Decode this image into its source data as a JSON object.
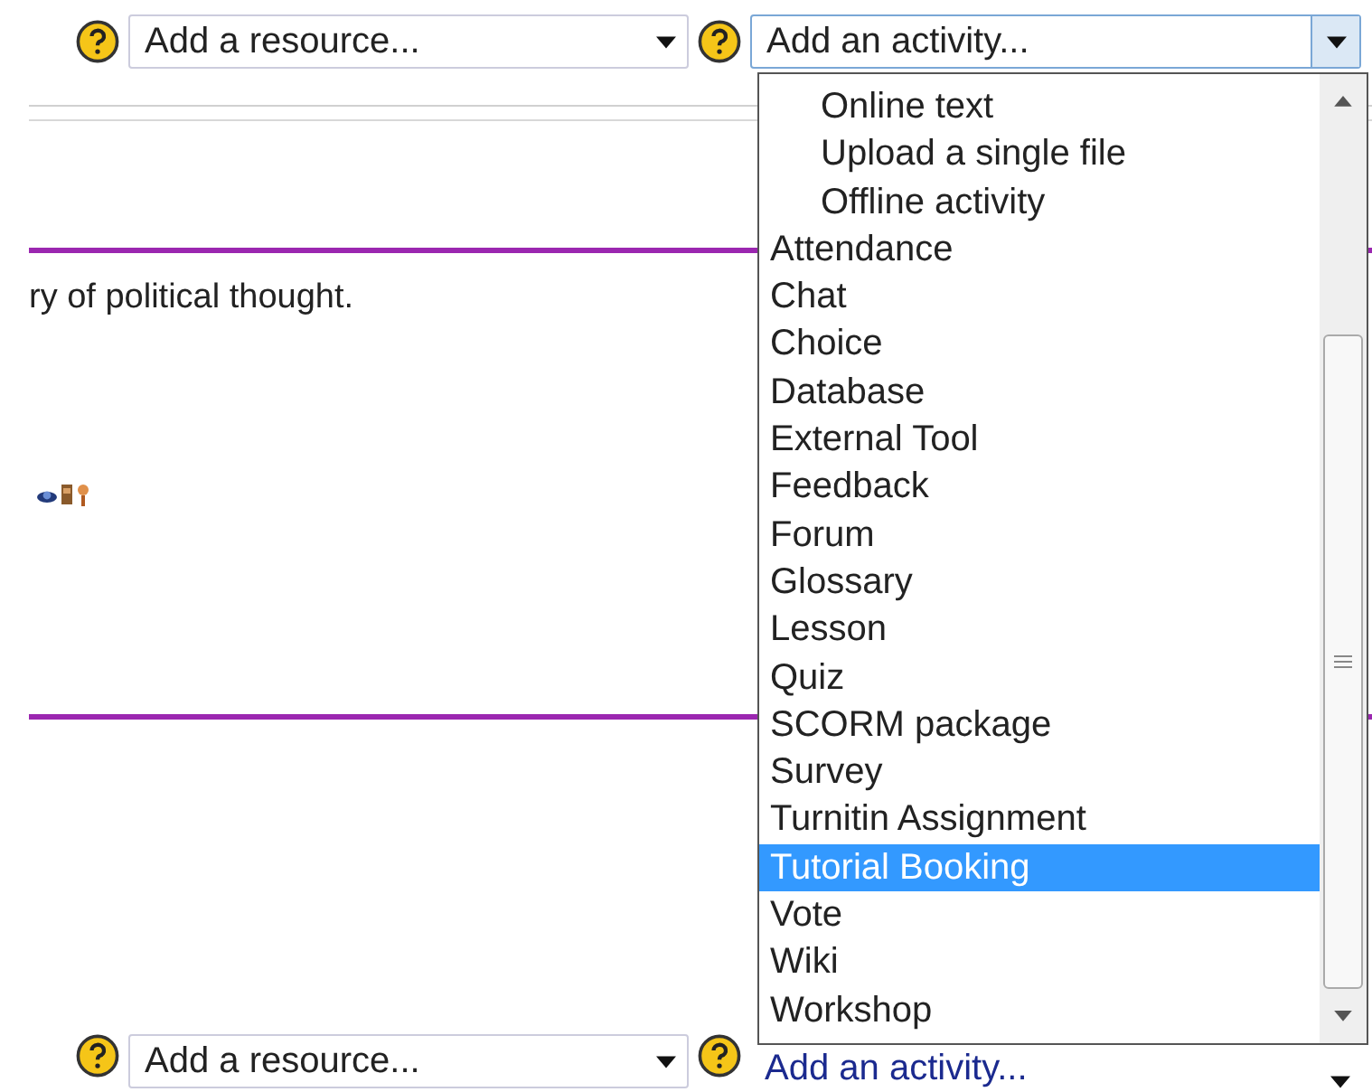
{
  "top_controls": {
    "resource_select": {
      "value": "Add a resource..."
    },
    "activity_select": {
      "value": "Add an activity...",
      "expanded": true
    }
  },
  "content": {
    "text": "ry of political thought."
  },
  "activity_list": [
    {
      "label": "Online text",
      "kind": "subitem",
      "selected": false
    },
    {
      "label": "Upload a single file",
      "kind": "subitem",
      "selected": false
    },
    {
      "label": "Offline activity",
      "kind": "subitem",
      "selected": false
    },
    {
      "label": "Attendance",
      "kind": "item",
      "selected": false
    },
    {
      "label": "Chat",
      "kind": "item",
      "selected": false
    },
    {
      "label": "Choice",
      "kind": "item",
      "selected": false
    },
    {
      "label": "Database",
      "kind": "item",
      "selected": false
    },
    {
      "label": "External Tool",
      "kind": "item",
      "selected": false
    },
    {
      "label": "Feedback",
      "kind": "item",
      "selected": false
    },
    {
      "label": "Forum",
      "kind": "item",
      "selected": false
    },
    {
      "label": "Glossary",
      "kind": "item",
      "selected": false
    },
    {
      "label": "Lesson",
      "kind": "item",
      "selected": false
    },
    {
      "label": "Quiz",
      "kind": "item",
      "selected": false
    },
    {
      "label": "SCORM package",
      "kind": "item",
      "selected": false
    },
    {
      "label": "Survey",
      "kind": "item",
      "selected": false
    },
    {
      "label": "Turnitin Assignment",
      "kind": "item",
      "selected": false
    },
    {
      "label": "Tutorial Booking",
      "kind": "item",
      "selected": true
    },
    {
      "label": "Vote",
      "kind": "item",
      "selected": false
    },
    {
      "label": "Wiki",
      "kind": "item",
      "selected": false
    },
    {
      "label": "Workshop",
      "kind": "item",
      "selected": false
    }
  ],
  "bottom_controls": {
    "resource_select": {
      "value": "Add a resource..."
    },
    "activity_select": {
      "value": "Add an activity..."
    }
  }
}
